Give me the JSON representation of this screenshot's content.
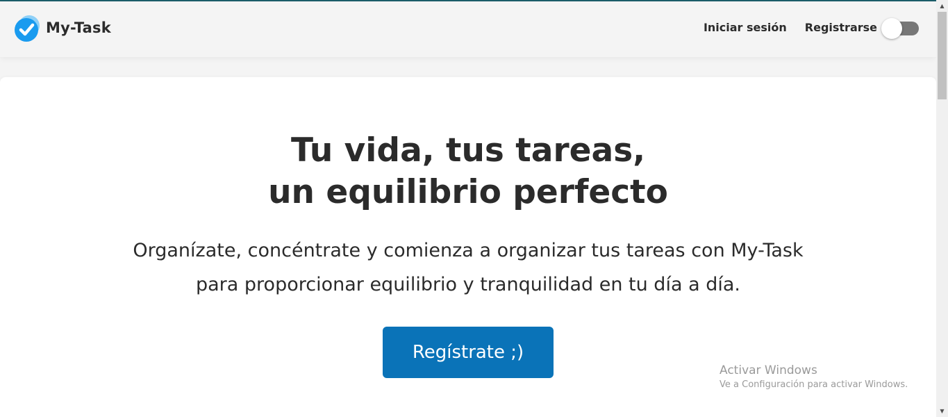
{
  "colors": {
    "primary": "#0a73b8",
    "brand_icon": "#1a9bef",
    "text": "#2b2b2b",
    "toggle_track": "#777777"
  },
  "navbar": {
    "brand_name": "My-Task",
    "brand_icon": "check-badge-icon",
    "login_label": "Iniciar sesión",
    "register_label": "Registrarse",
    "theme_toggle_on": false
  },
  "hero": {
    "title_line1": "Tu vida, tus tareas,",
    "title_line2": "un equilibrio perfecto",
    "subtitle_line1": "Organízate, concéntrate y comienza a organizar tus tareas con My-Task",
    "subtitle_line2": "para proporcionar equilibrio y tranquilidad en tu día a día.",
    "cta_label": "Regístrate ;)"
  },
  "watermark": {
    "title": "Activar Windows",
    "subtitle": "Ve a Configuración para activar Windows."
  }
}
